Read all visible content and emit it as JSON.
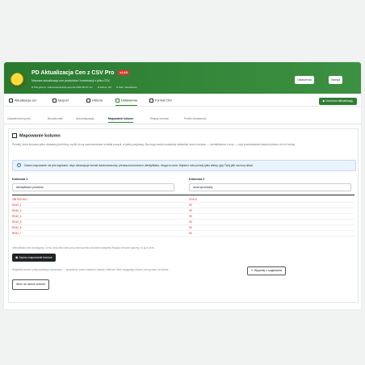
{
  "header": {
    "title": "PD Aktualizacja Cen z CSV Pro",
    "version": "v1.4.0",
    "subtitle": "Masowa aktualizacja cen produktów i kombinacji z pliku CSV",
    "meta": [
      "Plik główny: zakupowe/update-exports-2026-05-07.csv",
      "Status: OK",
      "Stan: aktualizacji"
    ],
    "buttons": [
      "Ustawienia",
      "Wersja"
    ]
  },
  "nav": {
    "tabs": [
      "Aktualizacja cen",
      "Eksport",
      "Historia",
      "Ustawienia",
      "Format CSV"
    ],
    "run_button": "Uruchom aktualizację"
  },
  "subtabs": [
    "Ustawienia importu",
    "Bezpieczniki",
    "Automatyzacja",
    "Mapowanie kolumn",
    "Reguły cenowe",
    "Profile dostawców"
  ],
  "panel": {
    "title": "Mapowanie kolumn",
    "intro": "Przesłij, która kolumna pliku dostawcy jest którą, a pliki do są rozmiarkowane w takiej pozycji, w jakiej przyjmują. Bez tego moduł szukałoby dokładnie dwóch kolumn — identyfikatora i ceny — czyli przesłaniania kolejnej kolumn do ich funkcji.",
    "info": "Żadne mapowanie nie jest zapisane, więc obowiązuje format dwukolumnowy: pierwsza kolumna to identyfikator, druga to cena. Wybierz role poniżej tylko wtedy, gdy Twój plik ma inny układ.",
    "col1": {
      "label": "Kolumna 1",
      "value": "Identyfikator produktu"
    },
    "col2": {
      "label": "Kolumna 2",
      "value": "cena sprzedaży"
    },
    "rows": [
      [
        "28875371617",
        "32.514"
      ],
      [
        "RING_1",
        "99"
      ],
      [
        "RING_2",
        "99"
      ],
      [
        "RING_4",
        "99"
      ],
      [
        "RING_5",
        "99"
      ],
      [
        "RING_6",
        "99"
      ],
      [
        "RING_7",
        "99"
      ]
    ],
    "note1": "Identyfikator jest wymagany. Cena, ilość albo stan przy zaznaczeniu kolumnie aktywnej Reguły cenowe wyłumy, ilu ją to brać.",
    "save_button": "Zapisz mapowanie kolumn",
    "note2": "Nagłówki kolumn podpowiadają mapowanie — sprawdź je przed zapisem; błędne trafienia, które wyglądają dobrze, jest gorsze niż żadne.",
    "detect_button": "Wypełnij z nagłówków",
    "reset_button": "Wróć do dwóch kolumn"
  }
}
